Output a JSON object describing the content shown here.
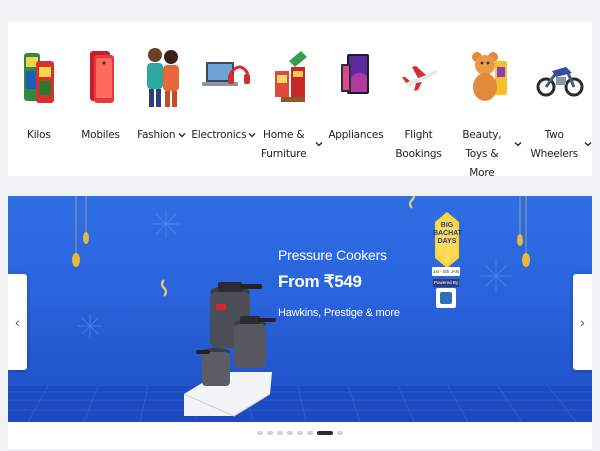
{
  "categories": [
    {
      "label": "Kilos",
      "has_dropdown": false,
      "icon": "grocery-icon"
    },
    {
      "label": "Mobiles",
      "has_dropdown": false,
      "icon": "mobile-phone-icon"
    },
    {
      "label": "Fashion",
      "has_dropdown": true,
      "icon": "fashion-models-icon"
    },
    {
      "label": "Electronics",
      "has_dropdown": true,
      "icon": "laptop-headphones-icon"
    },
    {
      "label": "Home & Furniture",
      "has_dropdown": true,
      "icon": "home-furniture-icon"
    },
    {
      "label": "Appliances",
      "has_dropdown": false,
      "icon": "tv-appliance-icon"
    },
    {
      "label": "Flight Bookings",
      "has_dropdown": false,
      "icon": "airplane-icon"
    },
    {
      "label": "Beauty, Toys & More",
      "has_dropdown": true,
      "icon": "teddy-bear-icon"
    },
    {
      "label": "Two Wheelers",
      "has_dropdown": true,
      "icon": "motorbike-icon"
    }
  ],
  "banner": {
    "title": "Pressure Cookers",
    "price": "From ₹549",
    "subtitle": "Hawkins, Prestige & more",
    "badge_text": "BIG BACHAT DAYS",
    "badge_dates": "1st - 5th JAN",
    "badge_powered": "Powered By",
    "prev_icon": "chevron-left-icon",
    "next_icon": "chevron-right-icon",
    "background_color": "#2a63dc",
    "slide_count": 8,
    "active_slide": 7
  },
  "colors": {
    "page_bg": "#f1f2f4",
    "card_bg": "#ffffff",
    "text": "#212121",
    "banner_blue": "#2a63dc",
    "gold": "#e8c24a"
  }
}
